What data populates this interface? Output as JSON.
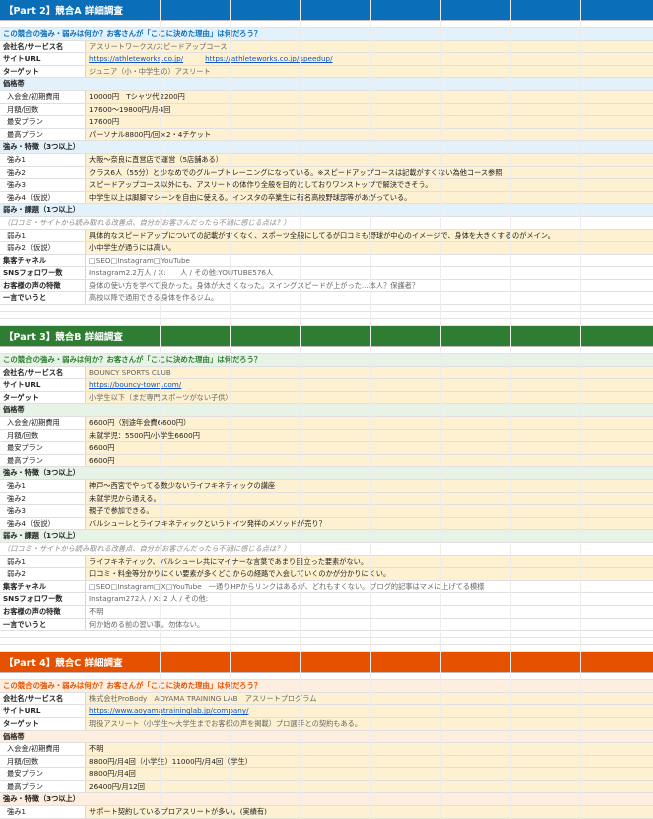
{
  "colors": {
    "part2": "#0b6eb8",
    "part3": "#2e7d32",
    "part4": "#e65100",
    "value_bg": "#fdf1d2",
    "link": "#1155cc"
  },
  "sections": [
    {
      "title": "【Part 2】競合A 詳細調査",
      "color": "#0b6eb8",
      "qcolor": "#0b6eb8",
      "qbg": "#e3f1fb",
      "question": "この競合の強み・弱みは何か？お客さんが「ここに決めた理由」は何だろう？",
      "info": [
        {
          "label": "会社名/サービス名",
          "value": "アスリートワークス/スピードアップコース",
          "gray": true
        },
        {
          "label": "サイトURL",
          "links": [
            "https://athleteworks.co.jp/",
            "https://athleteworks.co.jp/speedup/"
          ]
        },
        {
          "label": "ターゲット",
          "value": "ジュニア（小・中学生の）アスリート",
          "gray": true
        }
      ],
      "price_title": "価格帯",
      "prices": [
        {
          "label": "入会金/初期費用",
          "value": "10000円　Tシャツ代2200円"
        },
        {
          "label": "月額/回数",
          "value": "17600〜19800円/月4回"
        },
        {
          "label": "最安プラン",
          "value": "17600円"
        },
        {
          "label": "最高プラン",
          "value": "パーソナル8800円/回×2・4チケット"
        }
      ],
      "strength_title": "強み・特徴（3つ以上）",
      "strengths": [
        {
          "label": "強み1",
          "value": "大阪〜奈良に直営店で運営（5店舗ある）"
        },
        {
          "label": "強み2",
          "value": "クラス6人（55分）と少なめでのグループトレーニングになっている。※スピードアップコースは記載がすくない為他コース参照"
        },
        {
          "label": "強み3",
          "value": "スピードアップコース以外にも、アスリートの体作り全般を目的としておりワンストップで解決できそう。"
        },
        {
          "label": "強み4（仮説）",
          "value": "中学生以上は脚脚マシーンを自由に使える。インスタの卒業生に有名高校野球部等があがっている。"
        }
      ],
      "weak_title": "弱み・課題（1つ以上）",
      "weak_note": "（口コミ・サイトから読み取れる改善点、自分がお客さんだったら不満に感じる点は？）",
      "weaks": [
        {
          "label": "弱み1",
          "value": "具体的なスピードアップについての記載がすくなく、スポーツ全般にしてるが口コミも野球が中心のイメージで、身体を大きくするのがメイン。"
        },
        {
          "label": "弱み2（仮説）",
          "value": "小中学生が通うには高い。"
        }
      ],
      "extra": [
        {
          "label": "集客チャネル",
          "value": "□SEO□Instagram□YouTube",
          "gray": true
        },
        {
          "label": "SNSフォロワー数",
          "value": "Instagram2.2万人 / X:　　人 / その他:YOUTUBE576人",
          "gray": true
        },
        {
          "label": "お客様の声の特徴",
          "value": "身体の使い方を学べて良かった。身体が大きくなった。スイングスピードが上がった...本人？保護者？",
          "gray": true
        },
        {
          "label": "一言でいうと",
          "value": "高校以降で通用できる身体を作るジム。",
          "gray": true
        }
      ]
    },
    {
      "title": "【Part 3】競合B 詳細調査",
      "color": "#2e7d32",
      "qcolor": "#2e7d32",
      "qbg": "#e8f3e8",
      "question": "この競合の強み・弱みは何か？お客さんが「ここに決めた理由」は何だろう？",
      "info": [
        {
          "label": "会社名/サービス名",
          "value": "BOUNCY SPORTS CLUB",
          "gray": true
        },
        {
          "label": "サイトURL",
          "links": [
            "https://bouncy-town.com/"
          ]
        },
        {
          "label": "ターゲット",
          "value": "小学生以下（まだ専門スポーツがない子供）",
          "gray": true
        }
      ],
      "price_title": "価格帯",
      "prices": [
        {
          "label": "入会金/初期費用",
          "value": "6600円（別途年会費6600円）"
        },
        {
          "label": "月額/回数",
          "value": "未就学児：5500円/小学生6600円"
        },
        {
          "label": "最安プラン",
          "value": "6600円"
        },
        {
          "label": "最高プラン",
          "value": "6600円"
        }
      ],
      "strength_title": "強み・特徴（3つ以上）",
      "strengths": [
        {
          "label": "強み1",
          "value": "神戸〜西宮でやってる数少ないライフキネティックの講座"
        },
        {
          "label": "強み2",
          "value": "未就学児から通える。"
        },
        {
          "label": "強み3",
          "value": "親子で参加できる。"
        },
        {
          "label": "強み4（仮説）",
          "value": "バルシューレとライフキネティックというドイツ発祥のメソッドが売り？"
        }
      ],
      "weak_title": "弱み・課題（1つ以上）",
      "weak_note": "（口コミ・サイトから読み取れる改善点、自分がお客さんだったら不満に感じる点は？）",
      "weaks": [
        {
          "label": "弱み1",
          "value": "ライフキネティック、バルシューレ共にマイナーな言葉であまり目立った要素がない。"
        },
        {
          "label": "弱み2",
          "value": "口コミ・料金等分かりにくい要素が多くどこからの経路で入会していくのかが分かりにくい。"
        }
      ],
      "extra": [
        {
          "label": "集客チャネル",
          "value": "□SEO□Instagram□X□YouTube　一通りHPからリンクはあるが、どれもすくない。ブログ的記事はマメに上げてる模様",
          "gray": true
        },
        {
          "label": "SNSフォロワー数",
          "value": "Instagram272人 / X: 2 人 / その他:",
          "gray": true
        },
        {
          "label": "お客様の声の特徴",
          "value": "不明",
          "gray": true
        },
        {
          "label": "一言でいうと",
          "value": "何か始める前の習い事。勿体ない。",
          "gray": true
        }
      ]
    },
    {
      "title": "【Part 4】競合C 詳細調査",
      "color": "#e65100",
      "qcolor": "#e65100",
      "qbg": "#fdeee0",
      "question": "この競合の強み・弱みは何か？お客さんが「ここに決めた理由」は何だろう？",
      "info": [
        {
          "label": "会社名/サービス名",
          "value": "株式会社ProBody　AOYAMA TRAINING LAB　アスリートプログラム",
          "gray": true
        },
        {
          "label": "サイトURL",
          "links": [
            "https://www.aoyamatraininglab.jp/company/"
          ]
        },
        {
          "label": "ターゲット",
          "value": "現役アスリート（小学生〜大学生までお客様の声を掲載）プロ選手との契約もある。",
          "gray": true
        }
      ],
      "price_title": "価格帯",
      "prices": [
        {
          "label": "入会金/初期費用",
          "value": "不明"
        },
        {
          "label": "月額/回数",
          "value": "8800円/月4回（小学生）11000円/月4回（学生）"
        },
        {
          "label": "最安プラン",
          "value": "8800円/月4回"
        },
        {
          "label": "最高プラン",
          "value": "26400円/月12回"
        }
      ],
      "strength_title": "強み・特徴（3つ以上）",
      "strengths": [
        {
          "label": "強み1",
          "value": "サポート契約しているプロアスリートが多い。(実績有)"
        }
      ]
    }
  ]
}
